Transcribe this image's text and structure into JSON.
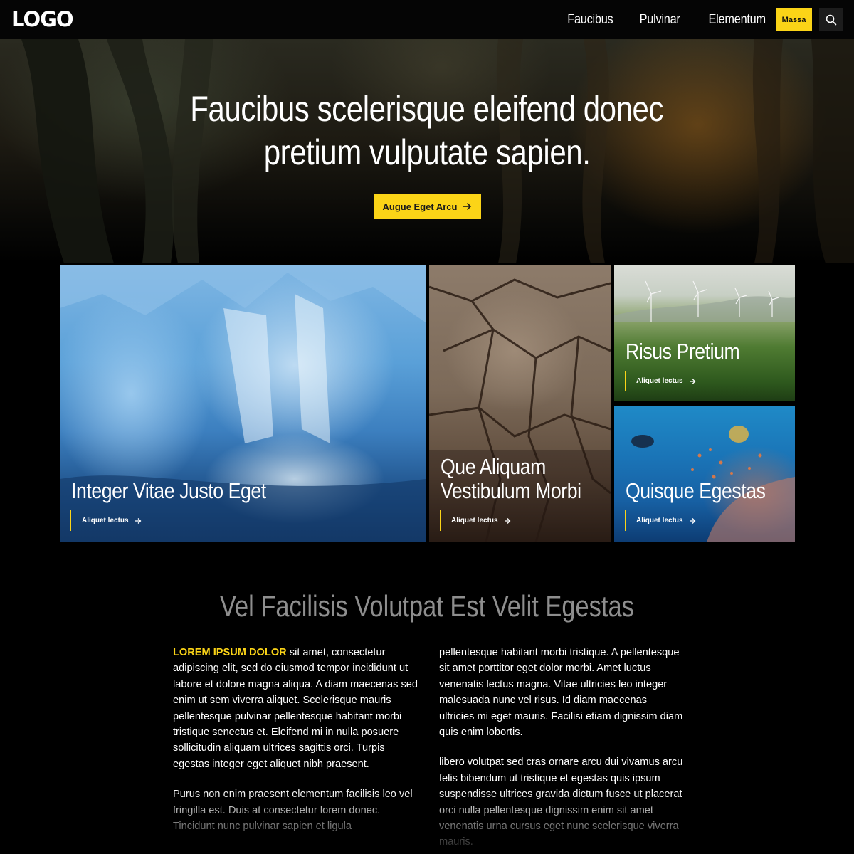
{
  "nav": {
    "logo": "LOGO",
    "links": [
      "Faucibus",
      "Pulvinar",
      "Elementum"
    ],
    "cta_label": "Massa",
    "search_icon": "search-icon"
  },
  "hero": {
    "title_line1": "Faucibus scelerisque eleifend donec",
    "title_line2": "pretium vulputate sapien.",
    "button_label": "Augue Eget Arcu",
    "button_icon": "arrow-right-icon"
  },
  "cards": [
    {
      "title_line1": "Integer Vitae Justo Eget",
      "title_line2": "",
      "link_label": "Aliquet lectus"
    },
    {
      "title_line1": "Que Aliquam",
      "title_line2": "Vestibulum Morbi",
      "link_label": "Aliquet lectus"
    },
    {
      "title_line1": "Risus Pretium",
      "title_line2": "",
      "link_label": "Aliquet lectus"
    },
    {
      "title_line1": "Quisque Egestas",
      "title_line2": "",
      "link_label": "Aliquet lectus"
    }
  ],
  "section": {
    "title": "Vel Facilisis Volutpat Est Velit Egestas",
    "lead": "LOREM IPSUM DOLOR",
    "left_p1": " sit amet, consectetur adipiscing elit, sed do eiusmod tempor incididunt ut labore et dolore magna aliqua. A diam maecenas sed enim ut sem viverra aliquet. Scelerisque mauris pellentesque pulvinar pellentesque habitant morbi tristique senectus et. Eleifend mi in nulla posuere sollicitudin aliquam ultrices sagittis orci. Turpis egestas integer eget aliquet nibh praesent.",
    "left_p2": "Purus non enim praesent elementum facilisis leo vel fringilla est. Duis at consectetur lorem donec. Tincidunt nunc pulvinar sapien et ligula",
    "right_p1": "pellentesque habitant morbi tristique. A pellentesque sit amet porttitor eget dolor morbi. Amet luctus venenatis lectus magna. Vitae ultricies leo integer malesuada nunc vel risus. Id diam maecenas ultricies mi eget mauris. Facilisi etiam dignissim diam quis enim lobortis.",
    "right_p2": "libero volutpat sed cras ornare arcu dui vivamus arcu felis bibendum ut tristique et egestas quis ipsum suspendisse ultrices gravida dictum fusce ut placerat orci nulla pellentesque dignissim enim sit amet venenatis urna cursus eget nunc scelerisque viverra mauris."
  },
  "colors": {
    "accent": "#fbd417",
    "background": "#000000",
    "section_title": "#8e8e8e"
  }
}
